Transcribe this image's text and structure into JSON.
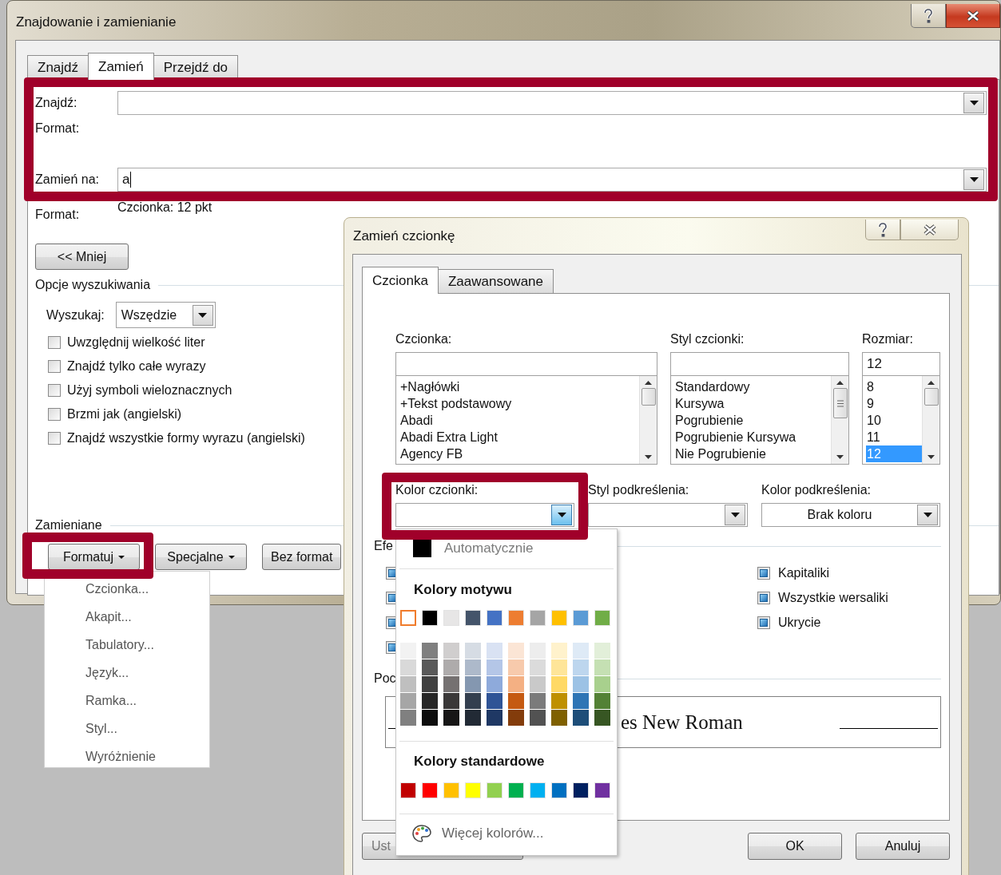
{
  "main_dialog": {
    "title": "Znajdowanie i zamienianie",
    "tabs": [
      {
        "label": "Znajdź",
        "selected": false
      },
      {
        "label": "Zamień",
        "selected": true
      },
      {
        "label": "Przejdź do",
        "selected": false
      }
    ],
    "find_label": "Znajdź:",
    "find_format_label": "Format:",
    "replace_label": "Zamień na:",
    "replace_value": "a",
    "replace_format_label": "Format:",
    "replace_format_value": "Czcionka: 12 pkt",
    "less_button": "<< Mniej",
    "search_options_title": "Opcje wyszukiwania",
    "search_label": "Wyszukaj:",
    "search_value": "Wszędzie",
    "options": [
      {
        "label": "Uwzględnij wielkość liter",
        "checked": false
      },
      {
        "label": "Znajdź tylko całe wyrazy",
        "checked": false
      },
      {
        "label": "Użyj symboli wieloznacznych",
        "checked": false
      },
      {
        "label": "Brzmi jak (angielski)",
        "checked": false
      },
      {
        "label": "Znajdź wszystkie formy wyrazu (angielski)",
        "checked": false
      }
    ],
    "replace_section_title": "Zamieniane",
    "buttons": [
      {
        "label": "Formatuj",
        "kind": "menu"
      },
      {
        "label": "Specjalne",
        "kind": "menu"
      },
      {
        "label": "Bez format",
        "kind": "plain"
      }
    ]
  },
  "format_menu": {
    "items": [
      "Czcionka...",
      "Akapit...",
      "Tabulatory...",
      "Język...",
      "Ramka...",
      "Styl...",
      "Wyróżnienie"
    ]
  },
  "font_dialog": {
    "title": "Zamień czcionkę",
    "tabs": [
      {
        "label": "Czcionka",
        "selected": true
      },
      {
        "label": "Zaawansowane",
        "selected": false
      }
    ],
    "font_label": "Czcionka:",
    "fonts": [
      {
        "label": "+Nagłówki",
        "selected": false
      },
      {
        "label": "+Tekst podstawowy",
        "selected": false
      },
      {
        "label": "Abadi",
        "selected": false
      },
      {
        "label": "Abadi Extra Light",
        "selected": false
      },
      {
        "label": "Agency FB",
        "selected": false
      }
    ],
    "style_label": "Styl czcionki:",
    "styles": [
      {
        "label": "Standardowy",
        "selected": false
      },
      {
        "label": "Kursywa",
        "selected": false
      },
      {
        "label": "Pogrubienie",
        "selected": false
      },
      {
        "label": "Pogrubienie Kursywa",
        "selected": false
      },
      {
        "label": "Nie Pogrubienie",
        "selected": false
      }
    ],
    "size_label": "Rozmiar:",
    "size_value": "12",
    "sizes": [
      {
        "label": "8",
        "selected": false
      },
      {
        "label": "9",
        "selected": false
      },
      {
        "label": "10",
        "selected": false
      },
      {
        "label": "11",
        "selected": false
      },
      {
        "label": "12",
        "selected": true
      }
    ],
    "font_color_label": "Kolor czcionki:",
    "underline_style_label": "Styl podkreślenia:",
    "underline_color_label": "Kolor podkreślenia:",
    "underline_color_value": "Brak koloru",
    "effects_title": "Efe",
    "effects_left": [
      {
        "indeterminate": true
      },
      {
        "indeterminate": true
      },
      {
        "indeterminate": true
      },
      {
        "indeterminate": true
      }
    ],
    "effects_right": [
      {
        "label": "Kapitaliki",
        "indeterminate": true
      },
      {
        "label": "Wszystkie wersaliki",
        "indeterminate": true
      },
      {
        "label": "Ukrycie",
        "indeterminate": true
      }
    ],
    "preview_title": "Poc",
    "preview_text": "es New Roman",
    "buttons": [
      {
        "label": "Ust",
        "kind": "left"
      },
      {
        "label": "OK",
        "kind": "right"
      },
      {
        "label": "Anuluj",
        "kind": "right"
      }
    ]
  },
  "color_popup": {
    "automatic": "Automatycznie",
    "theme_title": "Kolory motywu",
    "theme_colors": [
      {
        "color": "#ffffff",
        "selected": true
      },
      {
        "color": "#000000",
        "selected": false
      },
      {
        "color": "#e7e6e6",
        "selected": false
      },
      {
        "color": "#44546a",
        "selected": false
      },
      {
        "color": "#4472c4",
        "selected": false
      },
      {
        "color": "#ed7d31",
        "selected": false
      },
      {
        "color": "#a5a5a5",
        "selected": false
      },
      {
        "color": "#ffc000",
        "selected": false
      },
      {
        "color": "#5b9bd5",
        "selected": false
      },
      {
        "color": "#70ad47",
        "selected": false
      }
    ],
    "shades": [
      {
        "swatches": [
          {
            "color": "#f2f2f2"
          },
          {
            "color": "#d9d9d9"
          },
          {
            "color": "#bfbfbf"
          },
          {
            "color": "#a6a6a6"
          },
          {
            "color": "#808080"
          }
        ]
      },
      {
        "swatches": [
          {
            "color": "#7f7f7f"
          },
          {
            "color": "#595959"
          },
          {
            "color": "#404040"
          },
          {
            "color": "#262626"
          },
          {
            "color": "#0d0d0d"
          }
        ]
      },
      {
        "swatches": [
          {
            "color": "#d0cece"
          },
          {
            "color": "#aeabab"
          },
          {
            "color": "#757171"
          },
          {
            "color": "#3a3838"
          },
          {
            "color": "#171616"
          }
        ]
      },
      {
        "swatches": [
          {
            "color": "#d6dce4"
          },
          {
            "color": "#adb9ca"
          },
          {
            "color": "#8497b0"
          },
          {
            "color": "#333f4f"
          },
          {
            "color": "#222a35"
          }
        ]
      },
      {
        "swatches": [
          {
            "color": "#d9e2f3"
          },
          {
            "color": "#b4c6e7"
          },
          {
            "color": "#8eaadb"
          },
          {
            "color": "#2f5496"
          },
          {
            "color": "#1f3864"
          }
        ]
      },
      {
        "swatches": [
          {
            "color": "#fbe5d5"
          },
          {
            "color": "#f7caac"
          },
          {
            "color": "#f4b083"
          },
          {
            "color": "#c55a11"
          },
          {
            "color": "#833c0b"
          }
        ]
      },
      {
        "swatches": [
          {
            "color": "#ededed"
          },
          {
            "color": "#dbdbdb"
          },
          {
            "color": "#c9c9c9"
          },
          {
            "color": "#7b7b7b"
          },
          {
            "color": "#525252"
          }
        ]
      },
      {
        "swatches": [
          {
            "color": "#fff2cc"
          },
          {
            "color": "#fee599"
          },
          {
            "color": "#ffd965"
          },
          {
            "color": "#bf9000"
          },
          {
            "color": "#7f6000"
          }
        ]
      },
      {
        "swatches": [
          {
            "color": "#deeaf6"
          },
          {
            "color": "#bdd6ee"
          },
          {
            "color": "#9cc2e5"
          },
          {
            "color": "#2e75b5"
          },
          {
            "color": "#1e4e79"
          }
        ]
      },
      {
        "swatches": [
          {
            "color": "#e2efd9"
          },
          {
            "color": "#c5e0b3"
          },
          {
            "color": "#a8d08d"
          },
          {
            "color": "#538135"
          },
          {
            "color": "#375623"
          }
        ]
      }
    ],
    "standard_title": "Kolory standardowe",
    "standard_colors": [
      {
        "color": "#c00000"
      },
      {
        "color": "#ff0000"
      },
      {
        "color": "#ffc000"
      },
      {
        "color": "#ffff00"
      },
      {
        "color": "#92d050"
      },
      {
        "color": "#00b050"
      },
      {
        "color": "#00b0f0"
      },
      {
        "color": "#0070c0"
      },
      {
        "color": "#002060"
      },
      {
        "color": "#7030a0"
      }
    ],
    "more": "Więcej kolorów..."
  }
}
